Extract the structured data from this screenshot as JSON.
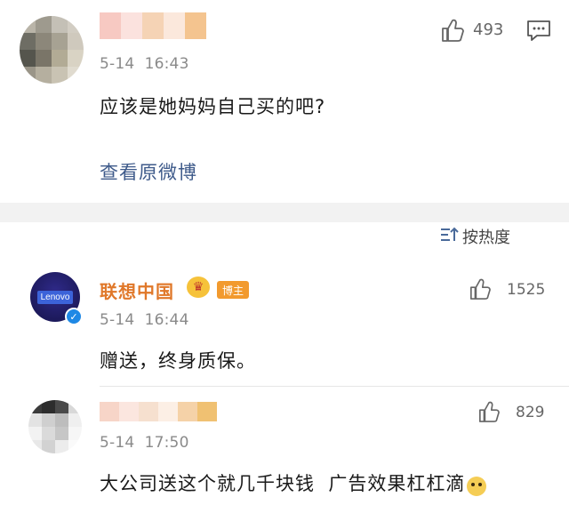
{
  "post": {
    "time": "5-14  16:43",
    "text": "应该是她妈妈自己买的吧?",
    "likes": "493",
    "view_link": "查看原微博"
  },
  "sort": {
    "label": "按热度"
  },
  "comments": [
    {
      "author": "联想中国",
      "badge": "博主",
      "time": "5-14  16:44",
      "text": "赠送，终身质保。",
      "likes": "1525",
      "avatar_logo": "Lenovo"
    },
    {
      "time": "5-14  17:50",
      "text": "大公司送这个就几千块钱  广告效果杠杠滴",
      "likes": "829"
    }
  ],
  "icons": [
    "thumb-up-icon",
    "comment-icon",
    "sort-icon",
    "crown-icon",
    "verified-icon",
    "dog-emoji-icon"
  ],
  "colors": {
    "link": "#3e5a8a",
    "author": "#e0782a",
    "badge": "#f29a2e",
    "divider": "#e6e6e6"
  }
}
